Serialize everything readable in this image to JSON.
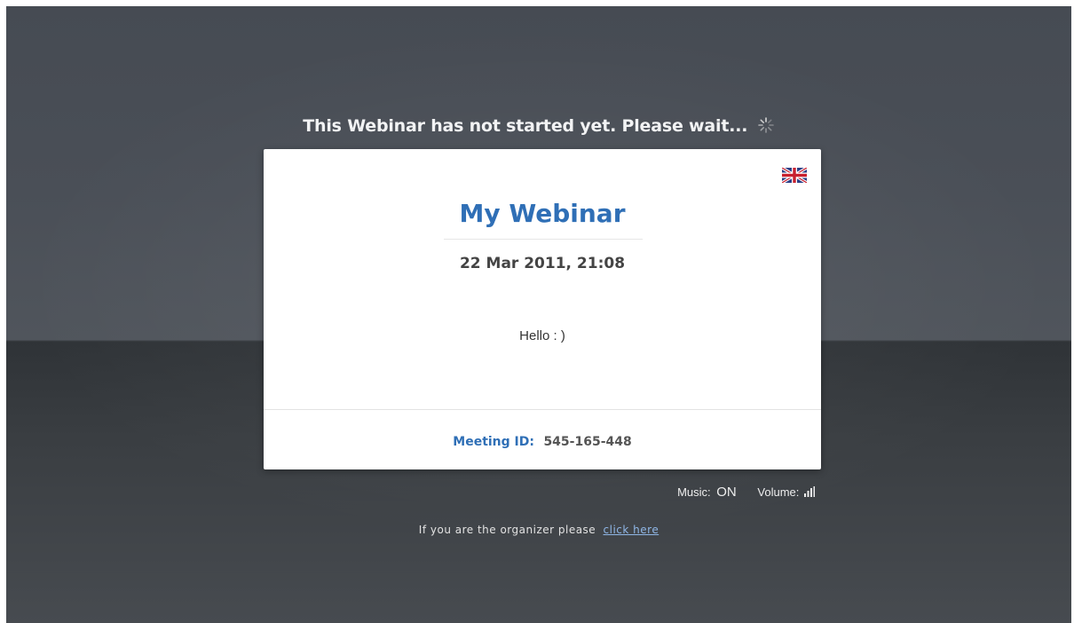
{
  "status": {
    "waiting_message": "This Webinar has not started yet. Please wait...",
    "spinner_icon": "spinner-icon"
  },
  "card": {
    "language_icon": "uk-flag-icon",
    "title": "My Webinar",
    "date_time": "22 Mar 2011, 21:08",
    "message": "Hello : )",
    "meeting_id_label": "Meeting ID:",
    "meeting_id_value": "545-165-448"
  },
  "audio": {
    "music_label": "Music:",
    "music_state": "ON",
    "volume_label": "Volume:",
    "volume_icon": "volume-bars-icon"
  },
  "organizer": {
    "prompt": "If you are the organizer please",
    "link_label": "click here"
  },
  "colors": {
    "accent_blue": "#2f6fb6",
    "link_blue": "#8fb6e6",
    "background_dark": "#464b53"
  }
}
